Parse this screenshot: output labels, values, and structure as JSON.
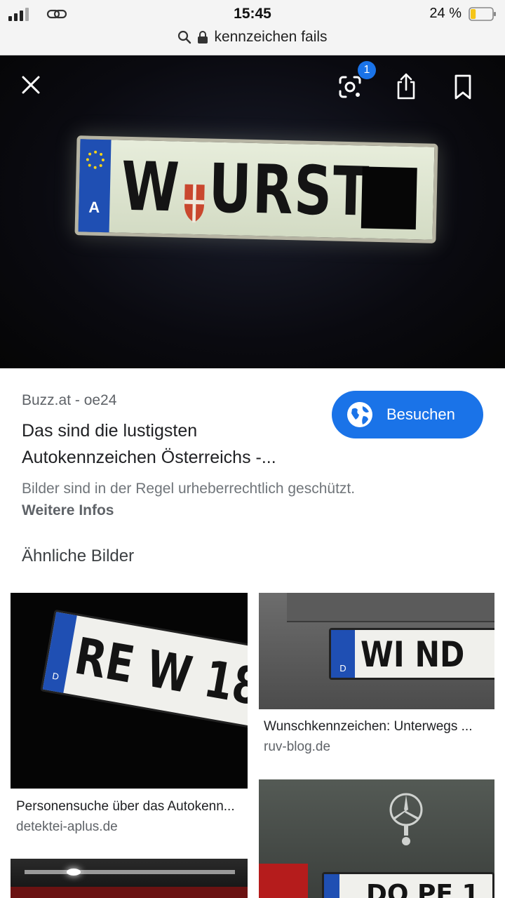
{
  "status_bar": {
    "time": "15:45",
    "battery_percent": "24 %",
    "battery_level": 0.24,
    "battery_color": "#f5c518"
  },
  "url_bar": {
    "text": "kennzeichen fails",
    "icons": [
      "search-icon",
      "lock-icon"
    ]
  },
  "viewer": {
    "icons": [
      "close-icon",
      "google-lens-icon",
      "share-icon",
      "bookmark-icon"
    ],
    "lens_badge": "1",
    "plate": {
      "country_letter": "A",
      "text_left": "W",
      "text_right": "URST"
    }
  },
  "result": {
    "source": "Buzz.at - oe24",
    "title": "Das sind die lustigsten Autokennzeichen Österreichs -...",
    "visit_label": "Besuchen",
    "copyright": "Bilder sind in der Regel urheberrechtlich geschützt.",
    "more_info": "Weitere Infos"
  },
  "similar": {
    "heading": "Ähnliche Bilder",
    "items": [
      {
        "caption": "Personensuche über das Autokenn...",
        "domain": "detektei-aplus.de",
        "plate_country": "D",
        "plate_text": "RE W 18"
      },
      {
        "caption": "Wunschkennzeichen: Unterwegs ...",
        "domain": "ruv-blog.de",
        "plate_country": "D",
        "plate_text": "WI ND"
      },
      {
        "caption": "",
        "domain": ""
      },
      {
        "caption": "",
        "domain": "",
        "plate_text": "DO PE 1"
      }
    ]
  },
  "colors": {
    "accent": "#1a73e8",
    "eu_blue": "#1f4fb3"
  }
}
